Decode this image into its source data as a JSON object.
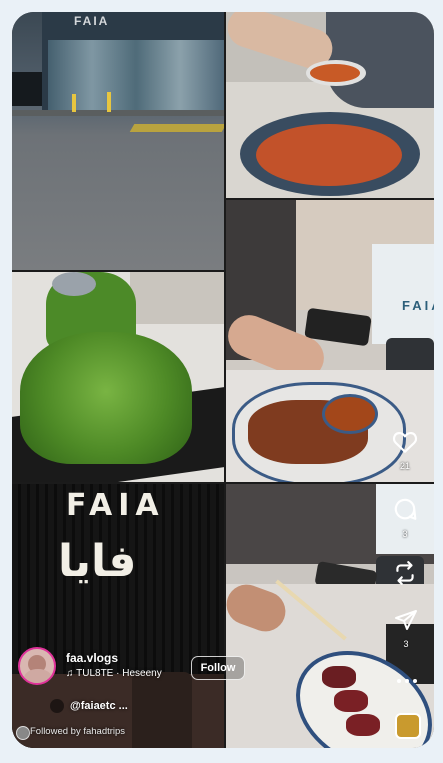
{
  "storefront": {
    "sign": "FAIA"
  },
  "wall_sign": {
    "latin": "FAIA",
    "arabic": "فايا"
  },
  "box_logo": "FAIA",
  "actions": {
    "likes": "21",
    "comments": "3",
    "shares": "3"
  },
  "user": {
    "username": "faa.vlogs",
    "music": "TUL8TE · Heseeny",
    "follow_label": "Follow",
    "tag": "@faiaetc ...",
    "followed_by": "Followed by fahadtrips"
  },
  "icons": {
    "like": "heart-icon",
    "comment": "comment-icon",
    "repost": "repost-icon",
    "share": "send-icon",
    "more": "more-icon",
    "music": "music-note-icon"
  }
}
